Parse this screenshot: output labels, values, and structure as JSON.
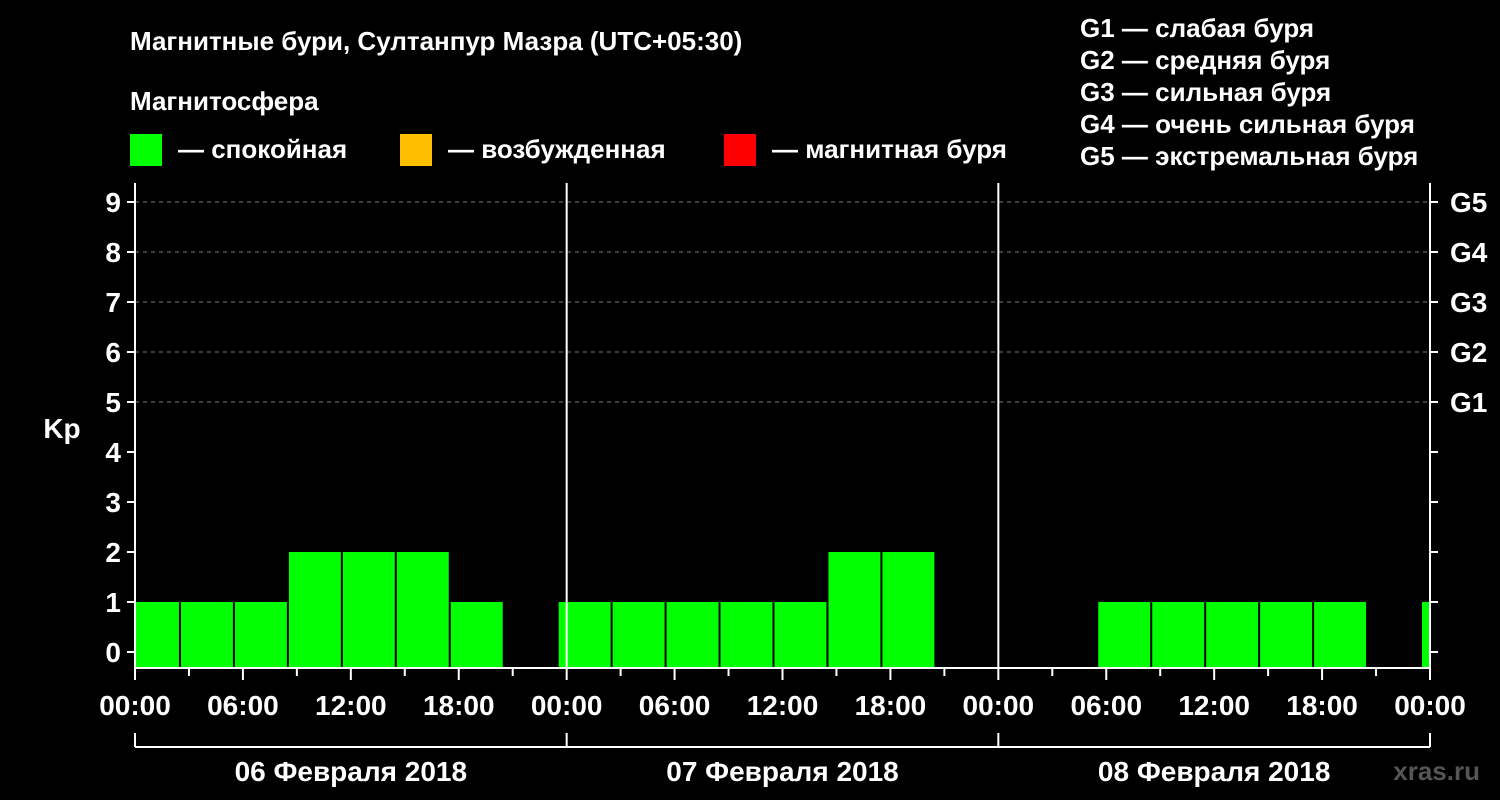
{
  "chart_data": {
    "type": "bar",
    "title": "Магнитные бури, Султанпур Мазра (UTC+05:30)",
    "legend_heading": "Магнитосфера",
    "legend": [
      {
        "label": "— спокойная",
        "color": "#00ff00"
      },
      {
        "label": "— возбужденная",
        "color": "#ffbf00"
      },
      {
        "label": "— магнитная буря",
        "color": "#ff0000"
      }
    ],
    "storm_scale": [
      "G1 — слабая буря",
      "G2 — средняя буря",
      "G3 — сильная буря",
      "G4 — очень сильная буря",
      "G5 — экстремальная буря"
    ],
    "ylabel": "Kp",
    "ylim": [
      0,
      9
    ],
    "y_ticks": [
      "0",
      "1",
      "2",
      "3",
      "4",
      "5",
      "6",
      "7",
      "8",
      "9"
    ],
    "right_axis_labels": [
      {
        "kp": 5,
        "label": "G1"
      },
      {
        "kp": 6,
        "label": "G2"
      },
      {
        "kp": 7,
        "label": "G3"
      },
      {
        "kp": 8,
        "label": "G4"
      },
      {
        "kp": 9,
        "label": "G5"
      }
    ],
    "x_tick_labels": [
      "00:00",
      "06:00",
      "12:00",
      "18:00",
      "00:00",
      "06:00",
      "12:00",
      "18:00",
      "00:00",
      "06:00",
      "12:00",
      "18:00",
      "00:00"
    ],
    "days": [
      "06 Февраля 2018",
      "07 Февраля 2018",
      "08 Февраля 2018"
    ],
    "grid": "dashed horizontal lines at Kp 5-9",
    "bars": [
      {
        "start": "06 Февраля 2018 00:00",
        "end": "06 Февраля 2018 02:30",
        "kp": 1
      },
      {
        "start": "06 Февраля 2018 02:30",
        "end": "06 Февраля 2018 05:30",
        "kp": 1
      },
      {
        "start": "06 Февраля 2018 05:30",
        "end": "06 Февраля 2018 08:30",
        "kp": 1
      },
      {
        "start": "06 Февраля 2018 08:30",
        "end": "06 Февраля 2018 11:30",
        "kp": 2
      },
      {
        "start": "06 Февраля 2018 11:30",
        "end": "06 Февраля 2018 14:30",
        "kp": 2
      },
      {
        "start": "06 Февраля 2018 14:30",
        "end": "06 Февраля 2018 17:30",
        "kp": 2
      },
      {
        "start": "06 Февраля 2018 17:30",
        "end": "06 Февраля 2018 20:30",
        "kp": 1
      },
      {
        "start": "06 Февраля 2018 23:30",
        "end": "07 Февраля 2018 02:30",
        "kp": 1
      },
      {
        "start": "07 Февраля 2018 02:30",
        "end": "07 Февраля 2018 05:30",
        "kp": 1
      },
      {
        "start": "07 Февраля 2018 05:30",
        "end": "07 Февраля 2018 08:30",
        "kp": 1
      },
      {
        "start": "07 Февраля 2018 08:30",
        "end": "07 Февраля 2018 11:30",
        "kp": 1
      },
      {
        "start": "07 Февраля 2018 11:30",
        "end": "07 Февраля 2018 14:30",
        "kp": 1
      },
      {
        "start": "07 Февраля 2018 14:30",
        "end": "07 Февраля 2018 17:30",
        "kp": 2
      },
      {
        "start": "07 Февраля 2018 17:30",
        "end": "07 Февраля 2018 20:30",
        "kp": 2
      },
      {
        "start": "08 Февраля 2018 05:30",
        "end": "08 Февраля 2018 08:30",
        "kp": 1
      },
      {
        "start": "08 Февраля 2018 08:30",
        "end": "08 Февраля 2018 11:30",
        "kp": 1
      },
      {
        "start": "08 Февраля 2018 11:30",
        "end": "08 Февраля 2018 14:30",
        "kp": 1
      },
      {
        "start": "08 Февраля 2018 14:30",
        "end": "08 Февраля 2018 17:30",
        "kp": 1
      },
      {
        "start": "08 Февраля 2018 17:30",
        "end": "08 Февраля 2018 20:30",
        "kp": 1
      },
      {
        "start": "08 Февраля 2018 23:30",
        "end": "09 Февраля 2018 00:00",
        "kp": 1
      }
    ],
    "bar_color": "#00ff00",
    "watermark": "xras.ru"
  }
}
